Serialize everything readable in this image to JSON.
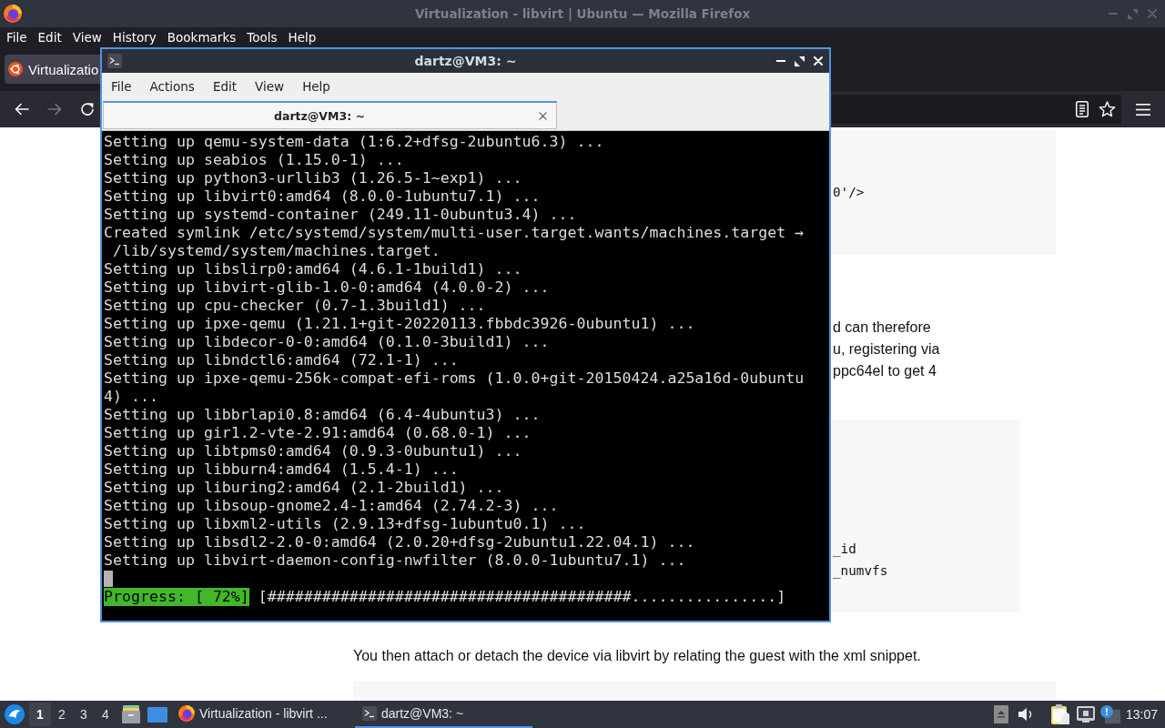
{
  "firefox": {
    "title": "Virtualization - libvirt | Ubuntu — Mozilla Firefox",
    "menu": [
      "File",
      "Edit",
      "View",
      "History",
      "Bookmarks",
      "Tools",
      "Help"
    ],
    "tabs": [
      {
        "label": "Virtualizatio",
        "selected": true
      }
    ],
    "nav_buttons": [
      {
        "kind": "back",
        "disabled": false
      },
      {
        "kind": "forward",
        "disabled": true
      },
      {
        "kind": "reload",
        "disabled": false
      }
    ],
    "page": {
      "blocks": [
        {
          "kind": "code",
          "lines": [
            "0'/>"
          ]
        },
        {
          "kind": "text",
          "lines": [
            "d can therefore",
            "u, registering via",
            "ppc64el to get 4"
          ]
        },
        {
          "kind": "code",
          "lines": [
            "_id",
            "_numvfs"
          ]
        },
        {
          "kind": "text",
          "lines": [
            "You then attach or detach the device via libvirt by relating the guest with the xml snippet."
          ]
        },
        {
          "kind": "code"
        }
      ]
    }
  },
  "terminal": {
    "title": "dartz@VM3: ~",
    "menu": [
      "File",
      "Actions",
      "Edit",
      "View",
      "Help"
    ],
    "tabs": [
      {
        "label": "dartz@VM3: ~",
        "selected": true
      }
    ],
    "lines": [
      "Setting up qemu-system-data (1:6.2+dfsg-2ubuntu6.3) ...",
      "Setting up seabios (1.15.0-1) ...",
      "Setting up python3-urllib3 (1.26.5-1~exp1) ...",
      "Setting up libvirt0:amd64 (8.0.0-1ubuntu7.1) ...",
      "Setting up systemd-container (249.11-0ubuntu3.4) ...",
      "Created symlink /etc/systemd/system/multi-user.target.wants/machines.target →",
      " /lib/systemd/system/machines.target.",
      "Setting up libslirp0:amd64 (4.6.1-1build1) ...",
      "Setting up libvirt-glib-1.0-0:amd64 (4.0.0-2) ...",
      "Setting up cpu-checker (0.7-1.3build1) ...",
      "Setting up ipxe-qemu (1.21.1+git-20220113.fbbdc3926-0ubuntu1) ...",
      "Setting up libdecor-0-0:amd64 (0.1.0-3build1) ...",
      "Setting up libndctl6:amd64 (72.1-1) ...",
      "Setting up ipxe-qemu-256k-compat-efi-roms (1.0.0+git-20150424.a25a16d-0ubuntu",
      "4) ...",
      "Setting up libbrlapi0.8:amd64 (6.4-4ubuntu3) ...",
      "Setting up gir1.2-vte-2.91:amd64 (0.68.0-1) ...",
      "Setting up libtpms0:amd64 (0.9.3-0ubuntu1) ...",
      "Setting up libburn4:amd64 (1.5.4-1) ...",
      "Setting up liburing2:amd64 (2.1-2build1) ...",
      "Setting up libsoup-gnome2.4-1:amd64 (2.74.2-3) ...",
      "Setting up libxml2-utils (2.9.13+dfsg-1ubuntu0.1) ...",
      "Setting up libsdl2-2.0-0:amd64 (2.0.20+dfsg-2ubuntu1.22.04.1) ...",
      "Setting up libvirt-daemon-config-nwfilter (8.0.0-1ubuntu7.1) ..."
    ],
    "cursor": true,
    "progress": {
      "label": "Progress: [ 72%]",
      "bar": "[########################################................]"
    }
  },
  "taskbar": {
    "workspaces": [
      {
        "label": "1",
        "selected": true
      },
      {
        "label": "2",
        "selected": false
      },
      {
        "label": "3",
        "selected": false
      },
      {
        "label": "4",
        "selected": false
      }
    ],
    "tasks": [
      {
        "kind": "browser",
        "label": "Virtualization - libvirt ...",
        "selected": false
      },
      {
        "kind": "terminal",
        "label": "dartz@VM3: ~",
        "selected": true
      }
    ],
    "clock": "13:07"
  }
}
